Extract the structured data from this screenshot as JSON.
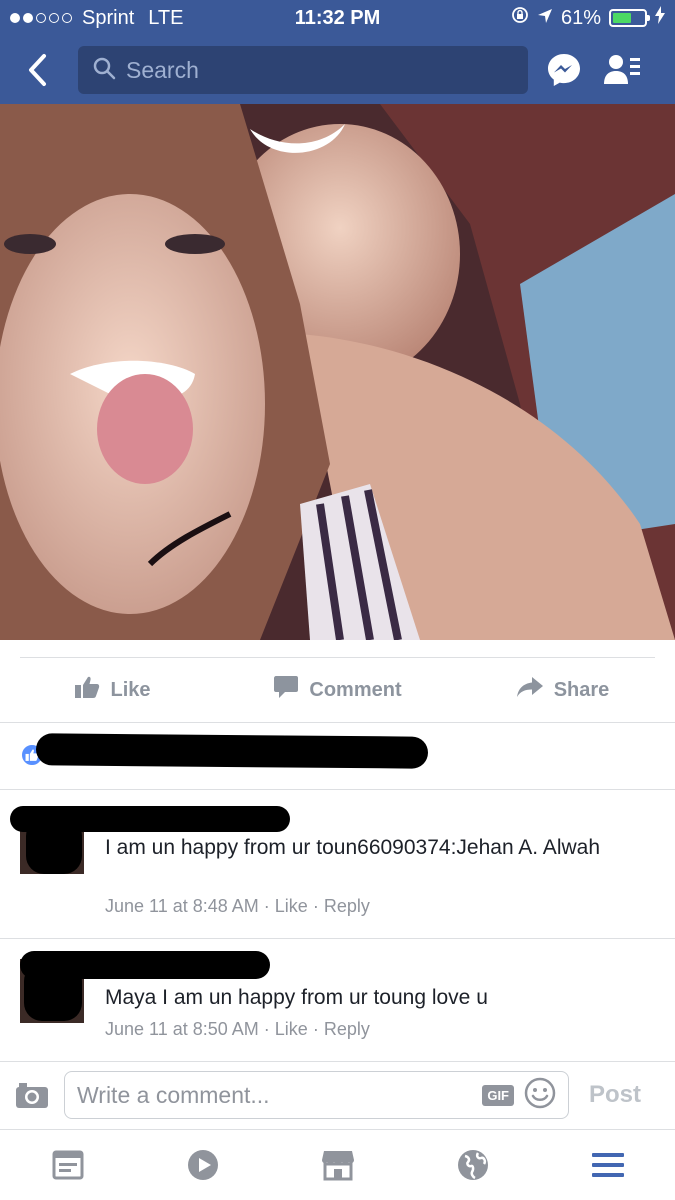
{
  "status_bar": {
    "carrier": "Sprint",
    "network": "LTE",
    "time": "11:32 PM",
    "battery": "61%",
    "battery_level": 0.61
  },
  "nav": {
    "search_placeholder": "Search",
    "icons": [
      "back-chevron-icon",
      "search-icon",
      "messenger-icon",
      "friend-requests-icon"
    ]
  },
  "actions": {
    "like_label": "Like",
    "comment_label": "Comment",
    "share_label": "Share"
  },
  "comments": [
    {
      "text": "I am un happy from ur toun66090374:Jehan A. Alwah",
      "timestamp": "June 11 at 8:48 AM",
      "like_label": "Like",
      "reply_label": "Reply"
    },
    {
      "text": "Maya I am un happy  from ur toung love u",
      "timestamp": "June 11 at 8:50 AM",
      "like_label": "Like",
      "reply_label": "Reply"
    }
  ],
  "composer": {
    "placeholder": "Write a comment...",
    "gif_label": "GIF",
    "post_label": "Post"
  },
  "colors": {
    "brand": "#3b5998",
    "like_blue": "#5890ff",
    "muted_text": "#90949c",
    "active_tab": "#4267b2"
  },
  "tab_bar": {
    "tabs": [
      "news-feed-icon",
      "video-icon",
      "marketplace-icon",
      "notifications-globe-icon",
      "menu-icon"
    ],
    "active": "menu-icon"
  }
}
